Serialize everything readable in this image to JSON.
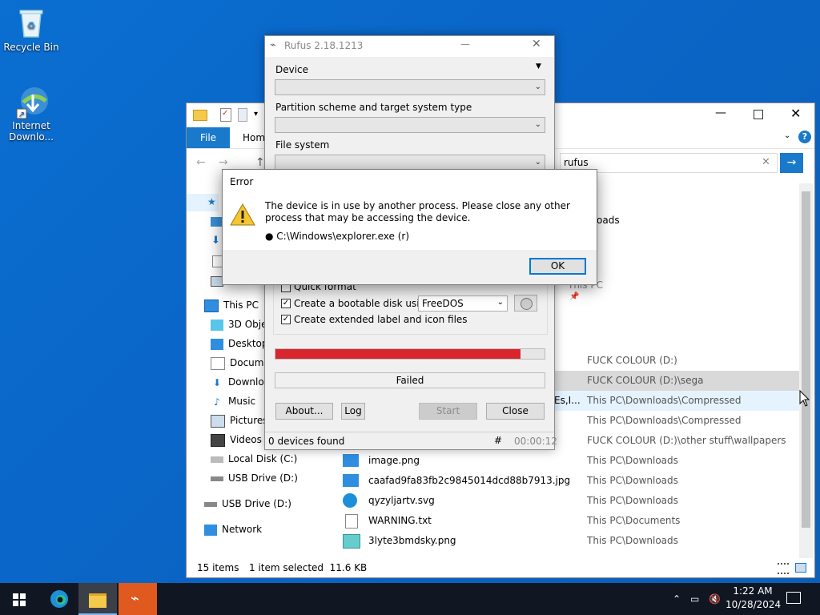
{
  "desktop": {
    "icons": [
      {
        "label": "Recycle Bin"
      },
      {
        "label": "Internet Downlo..."
      }
    ]
  },
  "explorer": {
    "ribbon": {
      "file": "File",
      "home": "Home"
    },
    "search": {
      "value": "rufus"
    },
    "nav": {
      "this_pc": "This PC",
      "objects_3d": "3D Objec",
      "desktop": "Desktop",
      "documents": "Docume",
      "downloads": "Downloa",
      "music": "Music",
      "pictures": "Pictures",
      "videos": "Videos",
      "local_disk": "Local Disk (C:)",
      "usb_drive": "USB Drive (D:)",
      "usb_drive_root": "USB Drive (D:)",
      "network": "Network"
    },
    "partial_labels": {
      "oads": "oads",
      "this_pc_short": "This PC",
      "es": "Es,I..."
    },
    "rows": [
      {
        "name": "",
        "location": "FUCK COLOUR (D:)"
      },
      {
        "name": "",
        "location": "FUCK COLOUR (D:)\\sega"
      },
      {
        "name": "",
        "location": "This PC\\Downloads\\Compressed"
      },
      {
        "name": "",
        "location": "This PC\\Downloads\\Compressed"
      },
      {
        "name": "",
        "location": "FUCK COLOUR (D:)\\other stuff\\wallpapers"
      },
      {
        "name": "image.png",
        "location": "This PC\\Downloads"
      },
      {
        "name": "caafad9fa83fb2c9845014dcd88b7913.jpg",
        "location": "This PC\\Downloads"
      },
      {
        "name": "qyzyljartv.svg",
        "location": "This PC\\Downloads"
      },
      {
        "name": "WARNING.txt",
        "location": "This PC\\Documents"
      },
      {
        "name": "3lyte3bmdsky.png",
        "location": "This PC\\Downloads"
      }
    ],
    "status": {
      "items": "15 items",
      "selected": "1 item selected  11.6 KB"
    }
  },
  "rufus": {
    "title": "Rufus 2.18.1213",
    "device_label": "Device",
    "partition_label": "Partition scheme and target system type",
    "filesystem_label": "File system",
    "quick_format": "Quick format",
    "bootable_label": "Create a bootable disk using",
    "bootable_option": "FreeDOS",
    "extended_label": "Create extended label and icon files",
    "progress_fraction": 0.91,
    "progress_color": "#d9252e",
    "status": "Failed",
    "buttons": {
      "about": "About...",
      "log": "Log",
      "start": "Start",
      "close": "Close"
    },
    "footer": {
      "devices": "0 devices found",
      "hash": "#",
      "time": "00:00:12"
    }
  },
  "error_dialog": {
    "title": "Error",
    "message": "The device is in use by another process. Please close any other process that may be accessing the device.",
    "process": "● C:\\Windows\\explorer.exe (r)",
    "ok": "OK"
  },
  "taskbar": {
    "time": "1:22 AM",
    "date": "10/28/2024"
  }
}
